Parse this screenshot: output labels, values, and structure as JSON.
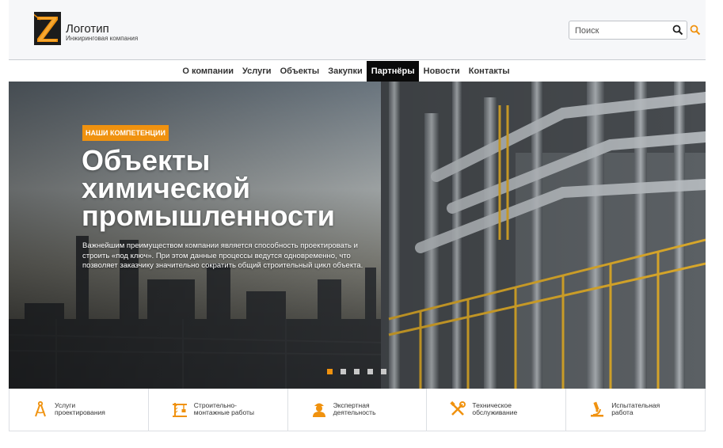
{
  "brand": {
    "title": "Логотип",
    "subtitle": "Инжиринговая компания"
  },
  "search": {
    "placeholder": "Поиск"
  },
  "nav": {
    "items": [
      {
        "label": "О компании"
      },
      {
        "label": "Услуги"
      },
      {
        "label": "Объекты"
      },
      {
        "label": "Закупки"
      },
      {
        "label": "Партнёры",
        "active": true
      },
      {
        "label": "Новости"
      },
      {
        "label": "Контакты"
      }
    ]
  },
  "hero": {
    "badge": "НАШИ КОМПЕТЕНЦИИ",
    "title_lines": [
      "Объекты",
      "химической",
      "промышленности"
    ],
    "text": "Важнейшим преимуществом компании является способность проектировать и строить «под ключ». При этом данные процессы ведутся одновременно, что позволяет заказчику значительно сократить общий строительный цикл объекта.",
    "slides_total": 5,
    "slide_active": 1
  },
  "services": [
    {
      "line1": "Услуги",
      "line2": "проектирования",
      "icon": "compass-icon"
    },
    {
      "line1": "Строительно-",
      "line2": "монтажные работы",
      "icon": "crane-icon"
    },
    {
      "line1": "Экспертная",
      "line2": "деятельность",
      "icon": "expert-icon"
    },
    {
      "line1": "Техническое",
      "line2": "обслуживание",
      "icon": "tools-icon"
    },
    {
      "line1": "Испытательная",
      "line2": "работа",
      "icon": "microscope-icon"
    }
  ],
  "colors": {
    "accent": "#f0920f",
    "nav_active_bg": "#0a0a0a",
    "header_bg": "#f6f7f9"
  }
}
